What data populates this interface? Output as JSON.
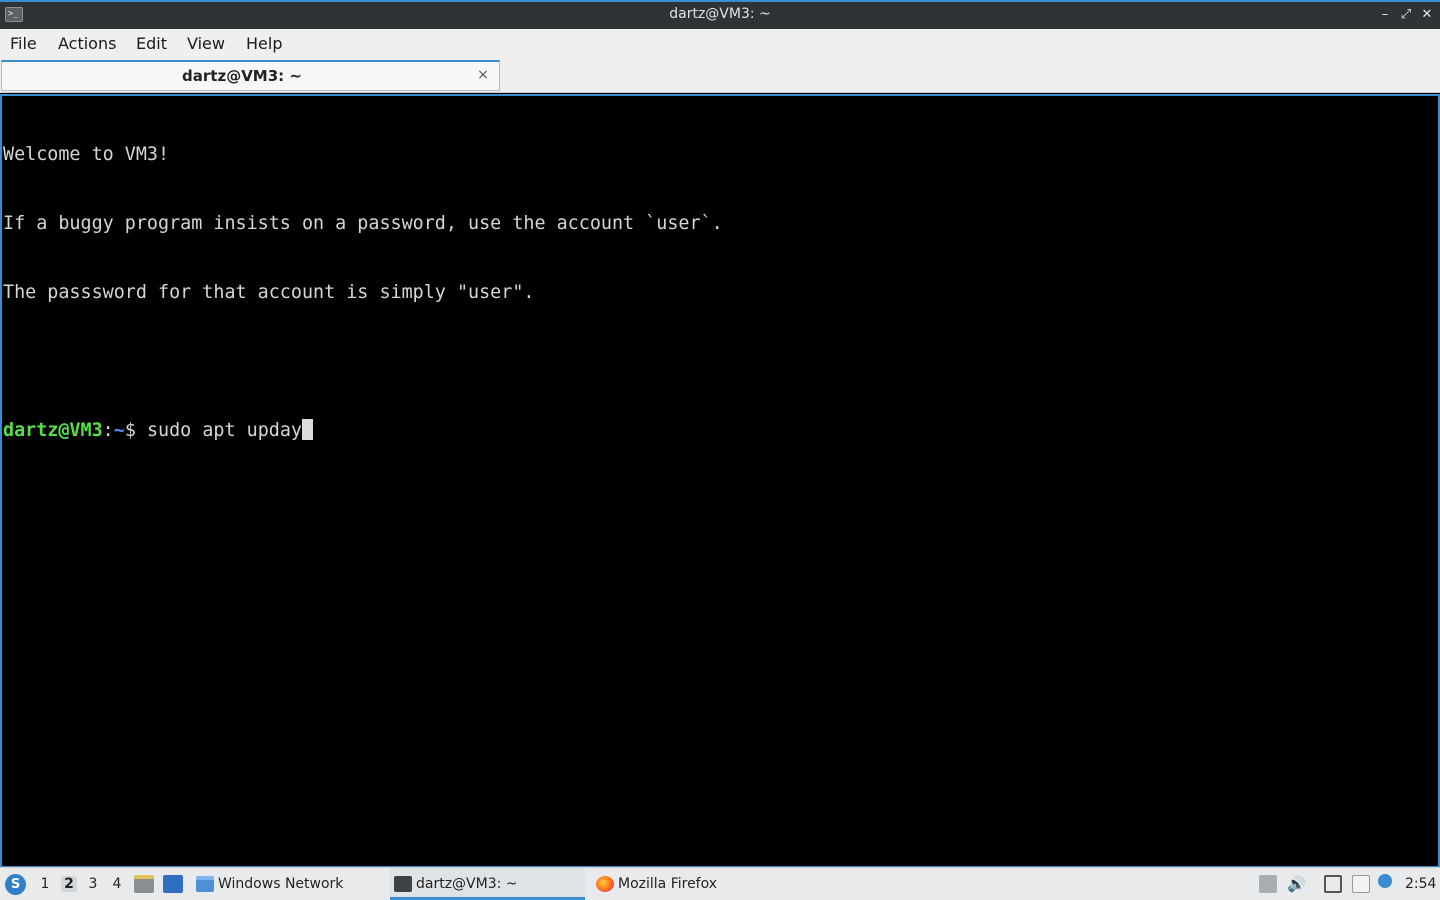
{
  "window": {
    "title": "dartz@VM3: ~",
    "app_icon_glyph": ">_",
    "controls": {
      "minimize": "–",
      "maximize": "⤢",
      "close": "✕"
    }
  },
  "menu": {
    "items": [
      "File",
      "Actions",
      "Edit",
      "View",
      "Help"
    ]
  },
  "tabs": [
    {
      "label": "dartz@VM3: ~",
      "close": "×"
    }
  ],
  "terminal": {
    "lines": [
      "Welcome to VM3!",
      "If a buggy program insists on a password, use the account `user`.",
      "The passsword for that account is simply \"user\"."
    ],
    "prompt": {
      "user_host": "dartz@VM3",
      "sep": ":",
      "path": "~",
      "symbol": "$ "
    },
    "command": "sudo apt upday"
  },
  "taskbar": {
    "start_glyph": "S",
    "workspaces": [
      "1",
      "2",
      "3",
      "4"
    ],
    "active_workspace": "2",
    "tasks": [
      {
        "label": "Windows Network",
        "icon": "folder-icon"
      },
      {
        "label": "dartz@VM3: ~",
        "icon": "terminal-icon"
      },
      {
        "label": "Mozilla Firefox",
        "icon": "firefox-icon"
      }
    ],
    "clock": "2:54"
  },
  "colors": {
    "accent": "#3b8dd0",
    "prompt_user": "#55e04a",
    "prompt_path": "#5a8cff",
    "terminal_bg": "#000000",
    "terminal_fg": "#d6d6d6"
  }
}
